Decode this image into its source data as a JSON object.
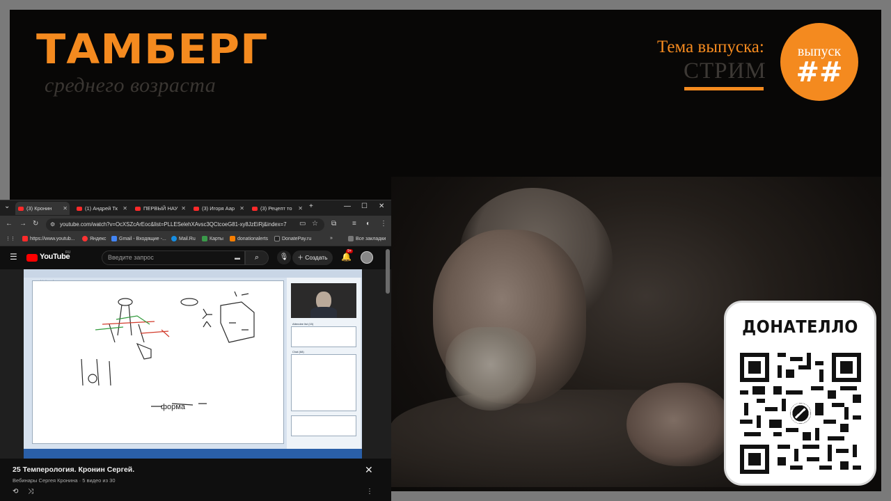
{
  "show": {
    "title": "ТАМБЕРГ",
    "subtitle": "среднего возраста",
    "topic_label": "Тема выпуска:",
    "topic_value": "СТРИМ",
    "episode_label": "выпуск",
    "episode_number": "##",
    "accent_color": "#f48a1f"
  },
  "donate": {
    "title": "ДОНАТЕЛЛО",
    "icon": "qr-code-icon"
  },
  "browser": {
    "tabs": [
      {
        "label": "(3) Кронин",
        "active": true
      },
      {
        "label": "(1) Андрей Тк"
      },
      {
        "label": "ПЕРВЫЙ НАУ"
      },
      {
        "label": "(3) Игоря Аар"
      },
      {
        "label": "(3) Рецепт то"
      }
    ],
    "url": "youtube.com/watch?v=OcXSZcArEoc&list=PLLESelehXAvsc3QCtcoeG81-xy8JzEiRj&index=7",
    "bookmarks": [
      "https://www.youtub...",
      "Яндекс",
      "Gmail - Входящие -...",
      "Mail.Ru",
      "Карты",
      "donationalerts",
      "DonatePay.ru"
    ],
    "all_bookmarks": "Все закладки"
  },
  "youtube": {
    "logo": "YouTube",
    "region": "RU",
    "search_placeholder": "Введите запрос",
    "create_label": "Создать",
    "notifications": "9+",
    "video_title": "25 Темперология. Кронин Сергей.",
    "playlist_info": "Вебинары Сергея Кронина · 5 видео из 30"
  },
  "webinar": {
    "window_title": "Whiteboard 1",
    "chat_label": "Chat (68)",
    "attendee_label": "Attendee list (15)",
    "sketch_text": "форма"
  }
}
